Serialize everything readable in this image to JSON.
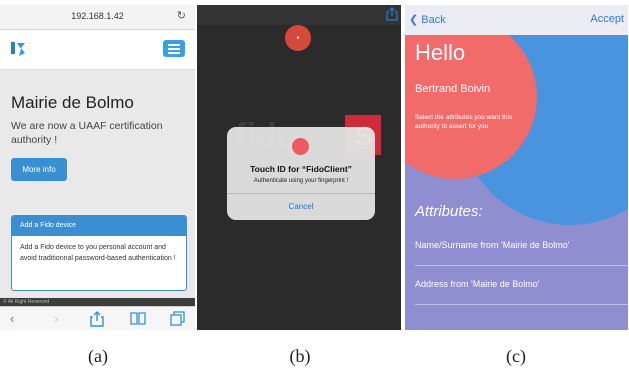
{
  "panel_a": {
    "url": "192.168.1.42",
    "title": "Mairie de Bolmo",
    "lead": "We are now a UAAF certification authority !",
    "more_info_label": "More info",
    "card_title": "Add a Fido device",
    "card_body": "Add a Fido device to you personal account and avoid traditionnal password-based authentication !",
    "footer": "© All Right Reserved",
    "caption": "(a)",
    "icons": {
      "reload": "reload-icon",
      "logo": "logo-icon",
      "menu": "hamburger-menu-icon",
      "back": "back-icon",
      "forward": "forward-icon",
      "share": "share-icon",
      "bookmarks": "bookmarks-icon",
      "tabs": "tabs-icon"
    },
    "colors": {
      "accent": "#3a8fd1"
    }
  },
  "panel_b": {
    "dialog_title": "Touch ID for “FidoClient”",
    "dialog_subtitle": "Authenticate using your fingerprint !",
    "cancel_label": "Cancel",
    "caption": "(b)",
    "icons": {
      "share": "share-icon",
      "app": "app-icon",
      "fingerprint": "fingerprint-icon"
    },
    "colors": {
      "fingerprint": "#ef5a62",
      "button": "#1a73d8"
    }
  },
  "panel_c": {
    "back_label": "Back",
    "accept_label": "Accept",
    "greeting": "Hello",
    "name": "Bertrand Boivin",
    "description": "Select the attributes you want this authority to assert for you",
    "attributes_title": "Attributes:",
    "attributes": [
      "Name/Surname from 'Mairie de Bolmo'",
      "Address from 'Mairie de Bolmo'"
    ],
    "caption": "(c)",
    "colors": {
      "coral": "#f26b6b",
      "blue": "#4a94df",
      "purple": "#8e8ed1"
    }
  }
}
